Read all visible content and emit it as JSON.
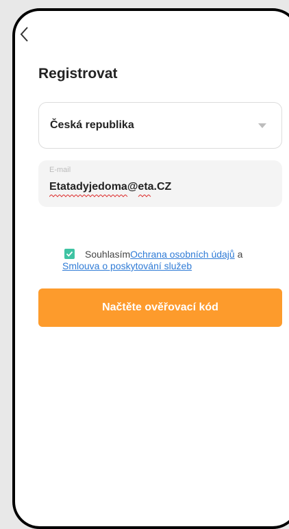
{
  "header": {
    "title": "Registrovat"
  },
  "form": {
    "country_value": "Česká republika",
    "email_label": "E-mail",
    "email_value": "Etatadyjedoma@eta.CZ"
  },
  "consent": {
    "checked": true,
    "prefix": "Souhlasím",
    "privacy_link": "Ochrana osobních údajů",
    "conjunction": " a",
    "terms_link": "Smlouva o poskytování služeb"
  },
  "actions": {
    "submit_label": "Načtěte ověřovací kód"
  },
  "colors": {
    "accent": "#fd9b2c",
    "checkbox": "#3fc3a3",
    "link": "#2f7bd6"
  },
  "icons": {
    "back": "chevron-left-icon",
    "dropdown": "caret-down-icon",
    "check": "check-icon"
  }
}
